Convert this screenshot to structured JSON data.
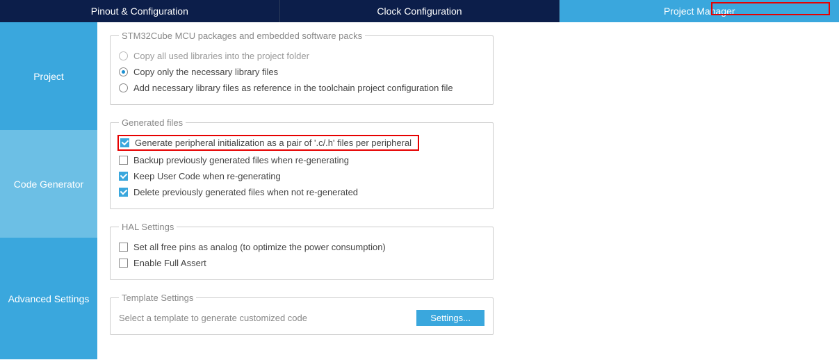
{
  "tabs": {
    "pinout": "Pinout & Configuration",
    "clock": "Clock Configuration",
    "project_manager": "Project Manager"
  },
  "sidebar": {
    "project": "Project",
    "code_generator": "Code Generator",
    "advanced": "Advanced Settings"
  },
  "packages": {
    "legend": "STM32Cube MCU packages and embedded software packs",
    "opt_copy_all": "Copy all used libraries into the project folder",
    "opt_copy_necessary": "Copy only the necessary library files",
    "opt_add_reference": "Add necessary library files as reference in the toolchain project configuration file"
  },
  "generated": {
    "legend": "Generated files",
    "opt_peripheral": "Generate peripheral initialization as a pair of '.c/.h' files per peripheral",
    "opt_backup": "Backup previously generated files when re-generating",
    "opt_keep_user": "Keep User Code when re-generating",
    "opt_delete": "Delete previously generated files when not re-generated"
  },
  "hal": {
    "legend": "HAL Settings",
    "opt_analog": "Set all free pins as analog (to optimize the power consumption)",
    "opt_assert": "Enable Full Assert"
  },
  "template": {
    "legend": "Template Settings",
    "text": "Select a template to generate customized code",
    "button": "Settings..."
  }
}
